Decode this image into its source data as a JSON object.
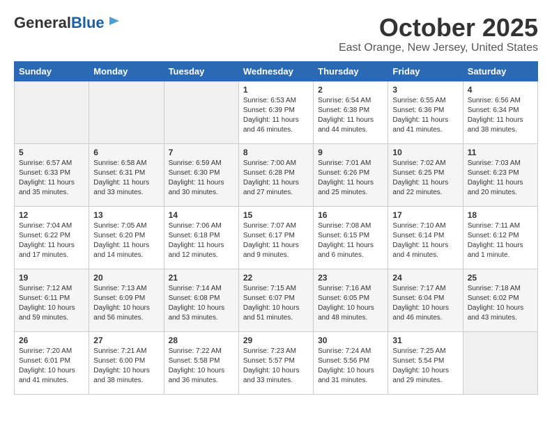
{
  "header": {
    "logo_general": "General",
    "logo_blue": "Blue",
    "title": "October 2025",
    "subtitle": "East Orange, New Jersey, United States"
  },
  "weekdays": [
    "Sunday",
    "Monday",
    "Tuesday",
    "Wednesday",
    "Thursday",
    "Friday",
    "Saturday"
  ],
  "weeks": [
    [
      {
        "day": "",
        "empty": true
      },
      {
        "day": "",
        "empty": true
      },
      {
        "day": "",
        "empty": true
      },
      {
        "day": "1",
        "sunrise": "6:53 AM",
        "sunset": "6:39 PM",
        "daylight": "11 hours and 46 minutes."
      },
      {
        "day": "2",
        "sunrise": "6:54 AM",
        "sunset": "6:38 PM",
        "daylight": "11 hours and 44 minutes."
      },
      {
        "day": "3",
        "sunrise": "6:55 AM",
        "sunset": "6:36 PM",
        "daylight": "11 hours and 41 minutes."
      },
      {
        "day": "4",
        "sunrise": "6:56 AM",
        "sunset": "6:34 PM",
        "daylight": "11 hours and 38 minutes."
      }
    ],
    [
      {
        "day": "5",
        "sunrise": "6:57 AM",
        "sunset": "6:33 PM",
        "daylight": "11 hours and 35 minutes."
      },
      {
        "day": "6",
        "sunrise": "6:58 AM",
        "sunset": "6:31 PM",
        "daylight": "11 hours and 33 minutes."
      },
      {
        "day": "7",
        "sunrise": "6:59 AM",
        "sunset": "6:30 PM",
        "daylight": "11 hours and 30 minutes."
      },
      {
        "day": "8",
        "sunrise": "7:00 AM",
        "sunset": "6:28 PM",
        "daylight": "11 hours and 27 minutes."
      },
      {
        "day": "9",
        "sunrise": "7:01 AM",
        "sunset": "6:26 PM",
        "daylight": "11 hours and 25 minutes."
      },
      {
        "day": "10",
        "sunrise": "7:02 AM",
        "sunset": "6:25 PM",
        "daylight": "11 hours and 22 minutes."
      },
      {
        "day": "11",
        "sunrise": "7:03 AM",
        "sunset": "6:23 PM",
        "daylight": "11 hours and 20 minutes."
      }
    ],
    [
      {
        "day": "12",
        "sunrise": "7:04 AM",
        "sunset": "6:22 PM",
        "daylight": "11 hours and 17 minutes."
      },
      {
        "day": "13",
        "sunrise": "7:05 AM",
        "sunset": "6:20 PM",
        "daylight": "11 hours and 14 minutes."
      },
      {
        "day": "14",
        "sunrise": "7:06 AM",
        "sunset": "6:18 PM",
        "daylight": "11 hours and 12 minutes."
      },
      {
        "day": "15",
        "sunrise": "7:07 AM",
        "sunset": "6:17 PM",
        "daylight": "11 hours and 9 minutes."
      },
      {
        "day": "16",
        "sunrise": "7:08 AM",
        "sunset": "6:15 PM",
        "daylight": "11 hours and 6 minutes."
      },
      {
        "day": "17",
        "sunrise": "7:10 AM",
        "sunset": "6:14 PM",
        "daylight": "11 hours and 4 minutes."
      },
      {
        "day": "18",
        "sunrise": "7:11 AM",
        "sunset": "6:12 PM",
        "daylight": "11 hours and 1 minute."
      }
    ],
    [
      {
        "day": "19",
        "sunrise": "7:12 AM",
        "sunset": "6:11 PM",
        "daylight": "10 hours and 59 minutes."
      },
      {
        "day": "20",
        "sunrise": "7:13 AM",
        "sunset": "6:09 PM",
        "daylight": "10 hours and 56 minutes."
      },
      {
        "day": "21",
        "sunrise": "7:14 AM",
        "sunset": "6:08 PM",
        "daylight": "10 hours and 53 minutes."
      },
      {
        "day": "22",
        "sunrise": "7:15 AM",
        "sunset": "6:07 PM",
        "daylight": "10 hours and 51 minutes."
      },
      {
        "day": "23",
        "sunrise": "7:16 AM",
        "sunset": "6:05 PM",
        "daylight": "10 hours and 48 minutes."
      },
      {
        "day": "24",
        "sunrise": "7:17 AM",
        "sunset": "6:04 PM",
        "daylight": "10 hours and 46 minutes."
      },
      {
        "day": "25",
        "sunrise": "7:18 AM",
        "sunset": "6:02 PM",
        "daylight": "10 hours and 43 minutes."
      }
    ],
    [
      {
        "day": "26",
        "sunrise": "7:20 AM",
        "sunset": "6:01 PM",
        "daylight": "10 hours and 41 minutes."
      },
      {
        "day": "27",
        "sunrise": "7:21 AM",
        "sunset": "6:00 PM",
        "daylight": "10 hours and 38 minutes."
      },
      {
        "day": "28",
        "sunrise": "7:22 AM",
        "sunset": "5:58 PM",
        "daylight": "10 hours and 36 minutes."
      },
      {
        "day": "29",
        "sunrise": "7:23 AM",
        "sunset": "5:57 PM",
        "daylight": "10 hours and 33 minutes."
      },
      {
        "day": "30",
        "sunrise": "7:24 AM",
        "sunset": "5:56 PM",
        "daylight": "10 hours and 31 minutes."
      },
      {
        "day": "31",
        "sunrise": "7:25 AM",
        "sunset": "5:54 PM",
        "daylight": "10 hours and 29 minutes."
      },
      {
        "day": "",
        "empty": true
      }
    ]
  ],
  "labels": {
    "sunrise_prefix": "Sunrise: ",
    "sunset_prefix": "Sunset: ",
    "daylight_prefix": "Daylight: "
  }
}
